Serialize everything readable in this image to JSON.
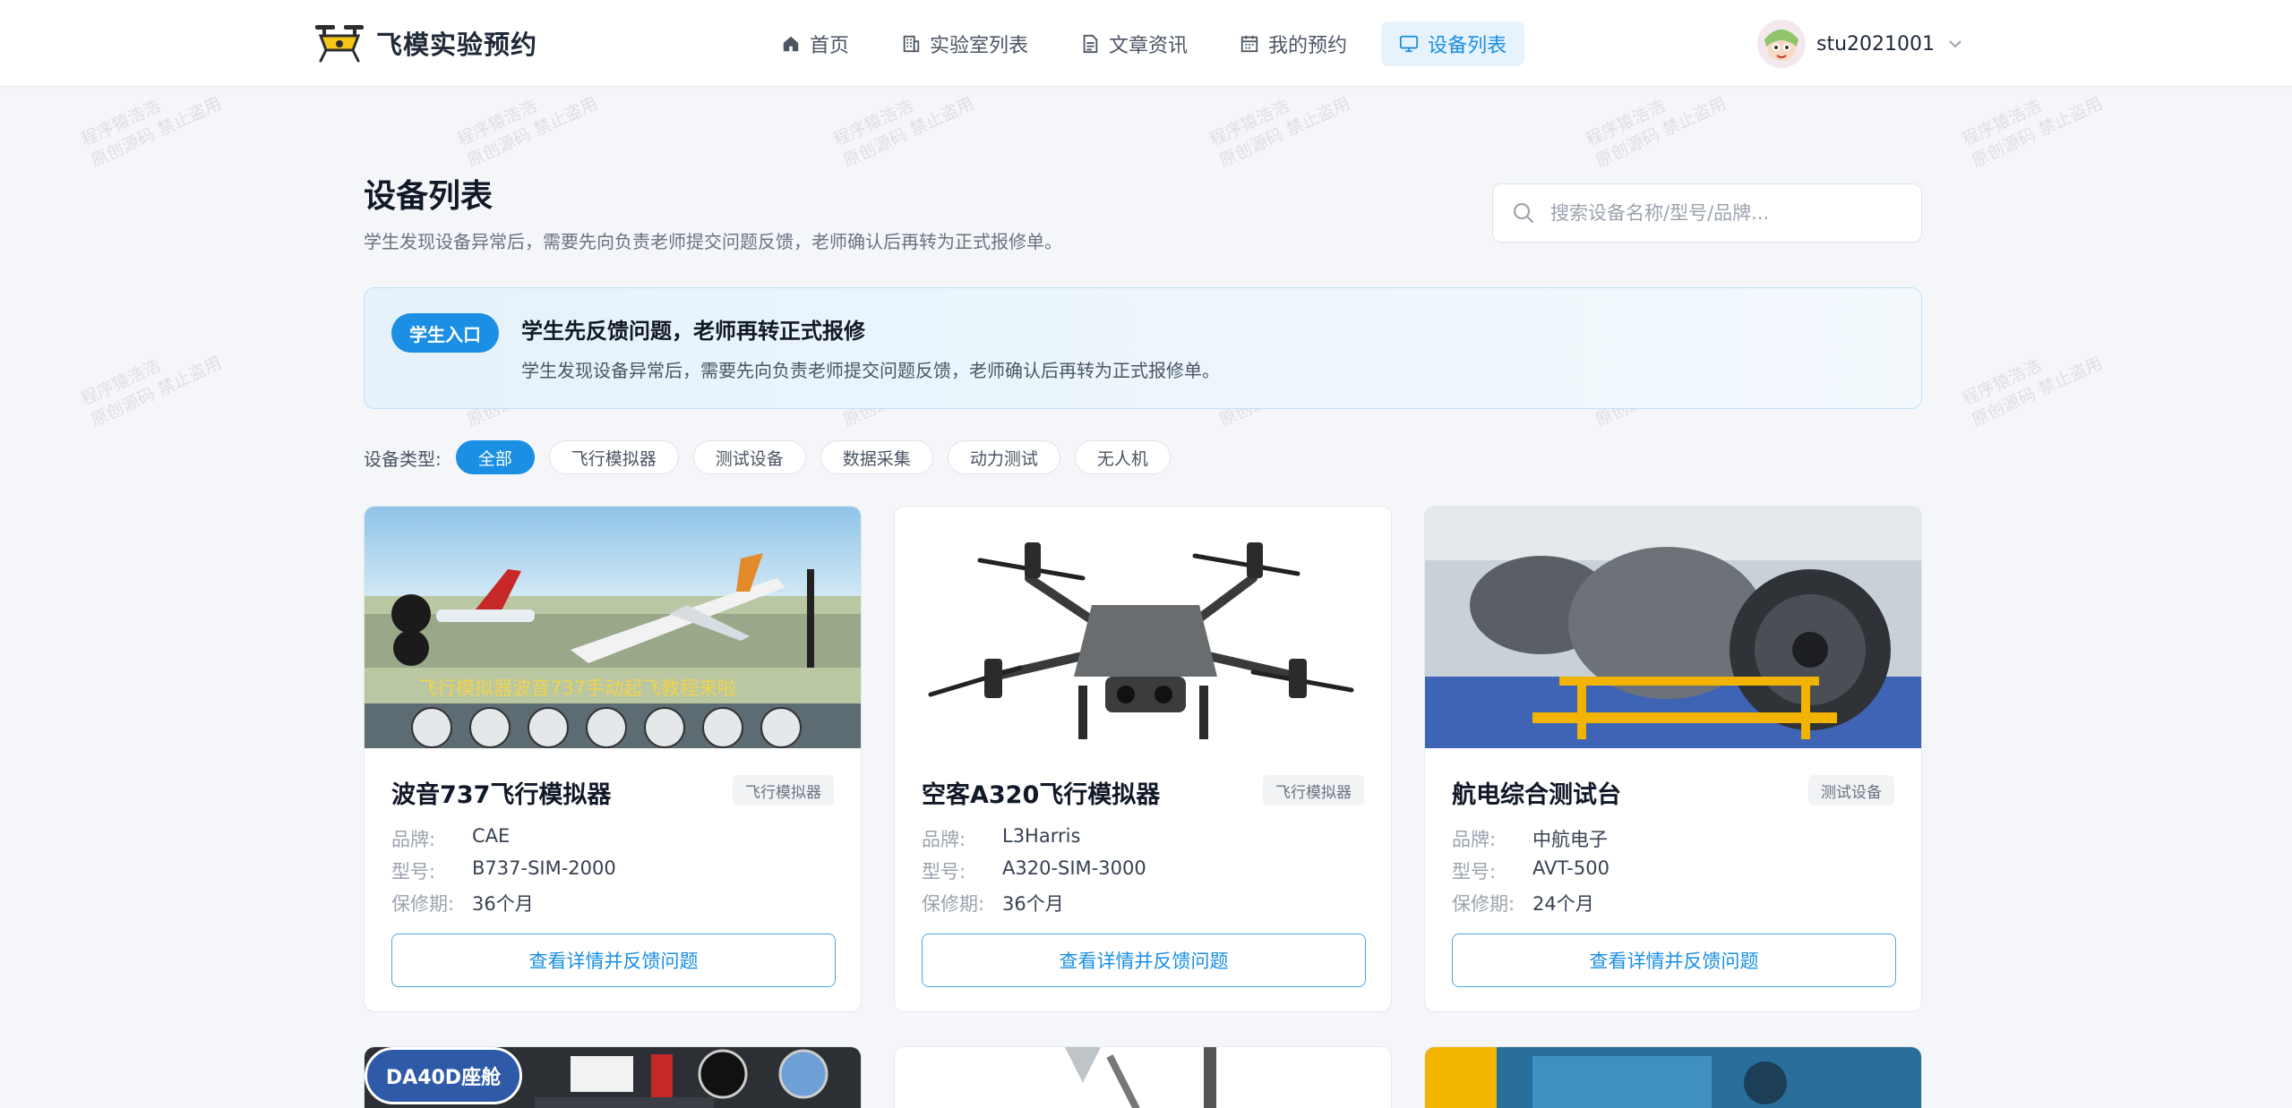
{
  "header": {
    "app_name": "飞模实验预约",
    "nav": [
      {
        "label": "首页",
        "icon": "home-icon",
        "active": false
      },
      {
        "label": "实验室列表",
        "icon": "building-icon",
        "active": false
      },
      {
        "label": "文章资讯",
        "icon": "document-icon",
        "active": false
      },
      {
        "label": "我的预约",
        "icon": "calendar-icon",
        "active": false
      },
      {
        "label": "设备列表",
        "icon": "monitor-icon",
        "active": true
      }
    ],
    "user": {
      "name": "stu2021001"
    }
  },
  "page": {
    "title": "设备列表",
    "subtitle": "学生发现设备异常后，需要先向负责老师提交问题反馈，老师确认后再转为正式报修单。",
    "search_placeholder": "搜索设备名称/型号/品牌..."
  },
  "banner": {
    "badge": "学生入口",
    "title": "学生先反馈问题，老师再转正式报修",
    "desc": "学生发现设备异常后，需要先向负责老师提交问题反馈，老师确认后再转为正式报修单。"
  },
  "filters": {
    "label": "设备类型:",
    "options": [
      "全部",
      "飞行模拟器",
      "测试设备",
      "数据采集",
      "动力测试",
      "无人机"
    ],
    "selected": "全部"
  },
  "spec_labels": {
    "brand": "品牌:",
    "model": "型号:",
    "warranty": "保修期:"
  },
  "devices": [
    {
      "name": "波音737飞行模拟器",
      "tag": "飞行模拟器",
      "brand": "CAE",
      "model": "B737-SIM-2000",
      "warranty": "36个月",
      "action": "查看详情并反馈问题",
      "image_caption": "飞行模拟器波音737手动起飞教程来啦"
    },
    {
      "name": "空客A320飞行模拟器",
      "tag": "飞行模拟器",
      "brand": "L3Harris",
      "model": "A320-SIM-3000",
      "warranty": "36个月",
      "action": "查看详情并反馈问题"
    },
    {
      "name": "航电综合测试台",
      "tag": "测试设备",
      "brand": "中航电子",
      "model": "AVT-500",
      "warranty": "24个月",
      "action": "查看详情并反馈问题"
    }
  ],
  "partial_cards": [
    {
      "badge": "DA40D座舱"
    }
  ],
  "watermark": [
    "程序猿浩浩",
    "原创源码 禁止盗用"
  ],
  "colors": {
    "accent": "#1a8fe3",
    "banner_bg": "#e5f2fb"
  }
}
